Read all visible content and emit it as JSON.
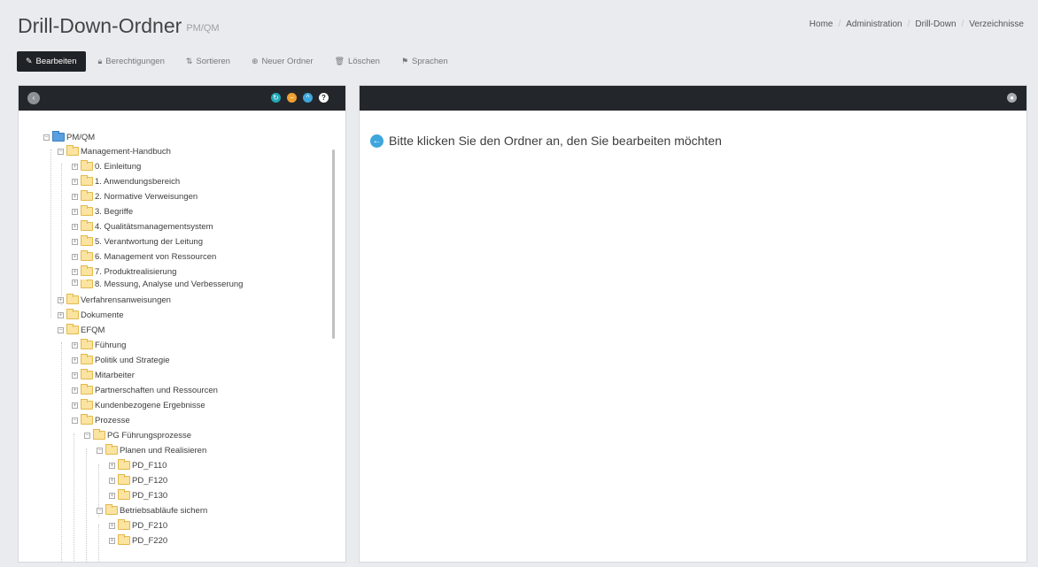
{
  "header": {
    "title": "Drill-Down-Ordner",
    "subtitle": "PM/QM",
    "breadcrumb": [
      "Home",
      "Administration",
      "Drill-Down",
      "Verzeichnisse"
    ]
  },
  "toolbar": {
    "edit": "Bearbeiten",
    "permissions": "Berechtigungen",
    "sort": "Sortieren",
    "new_folder": "Neuer Ordner",
    "delete": "Löschen",
    "languages": "Sprachen"
  },
  "tree": {
    "root": "PM/QM",
    "handbook": "Management-Handbuch",
    "h0": "0. Einleitung",
    "h1": "1. Anwendungsbereich",
    "h2": "2. Normative Verweisungen",
    "h3": "3. Begriffe",
    "h4": "4. Qualitätsmanagementsystem",
    "h5": "5. Verantwortung der Leitung",
    "h6": "6. Management von Ressourcen",
    "h7": "7. Produktrealisierung",
    "h8": "8. Messung, Analyse und Verbesserung",
    "procedures": "Verfahrensanweisungen",
    "documents": "Dokumente",
    "efqm": "EFQM",
    "e1": "Führung",
    "e2": "Politik und Strategie",
    "e3": "Mitarbeiter",
    "e4": "Partnerschaften und Ressourcen",
    "e5": "Kundenbezogene Ergebnisse",
    "e6": "Prozesse",
    "pg": "PG Führungsprozesse",
    "plan": "Planen und Realisieren",
    "f110": "PD_F110",
    "f120": "PD_F120",
    "f130": "PD_F130",
    "ops": "Betriebsabläufe sichern",
    "f210": "PD_F210",
    "f220": "PD_F220"
  },
  "main": {
    "message": "Bitte klicken Sie den Ordner an, den Sie bearbeiten möchten"
  },
  "icons": {
    "edit": "pencil-icon",
    "permissions": "lock-icon",
    "sort": "sort-icon",
    "new_folder": "plus-circle-icon",
    "delete": "trash-icon",
    "languages": "language-icon"
  }
}
